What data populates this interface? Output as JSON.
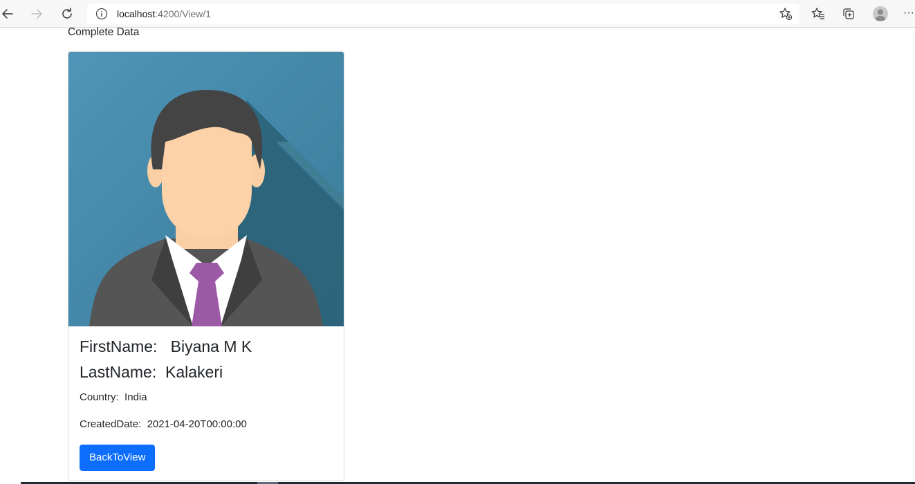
{
  "browser": {
    "url_host": "localhost",
    "url_path": ":4200/View/1"
  },
  "page": {
    "heading": "Complete Data"
  },
  "card": {
    "first_name_label": "FirstName:",
    "first_name_value": "Biyana M K",
    "last_name_label": "LastName:",
    "last_name_value": "Kalakeri",
    "country_label": "Country:",
    "country_value": "India",
    "created_label": "CreatedDate:",
    "created_value": "2021-04-20T00:00:00",
    "back_button_label": "BackToView"
  },
  "icons": {
    "back": "back-arrow-icon",
    "forward": "forward-arrow-icon",
    "reload": "reload-icon",
    "info": "info-icon",
    "add_favorite": "star-add-icon",
    "favorites": "favorites-icon",
    "collections": "collections-icon",
    "profile": "profile-avatar-icon",
    "more": "more-icon"
  },
  "colors": {
    "primary_button": "#0d6efd",
    "avatar_background": "#4a8db0",
    "tie": "#9b59a6"
  }
}
